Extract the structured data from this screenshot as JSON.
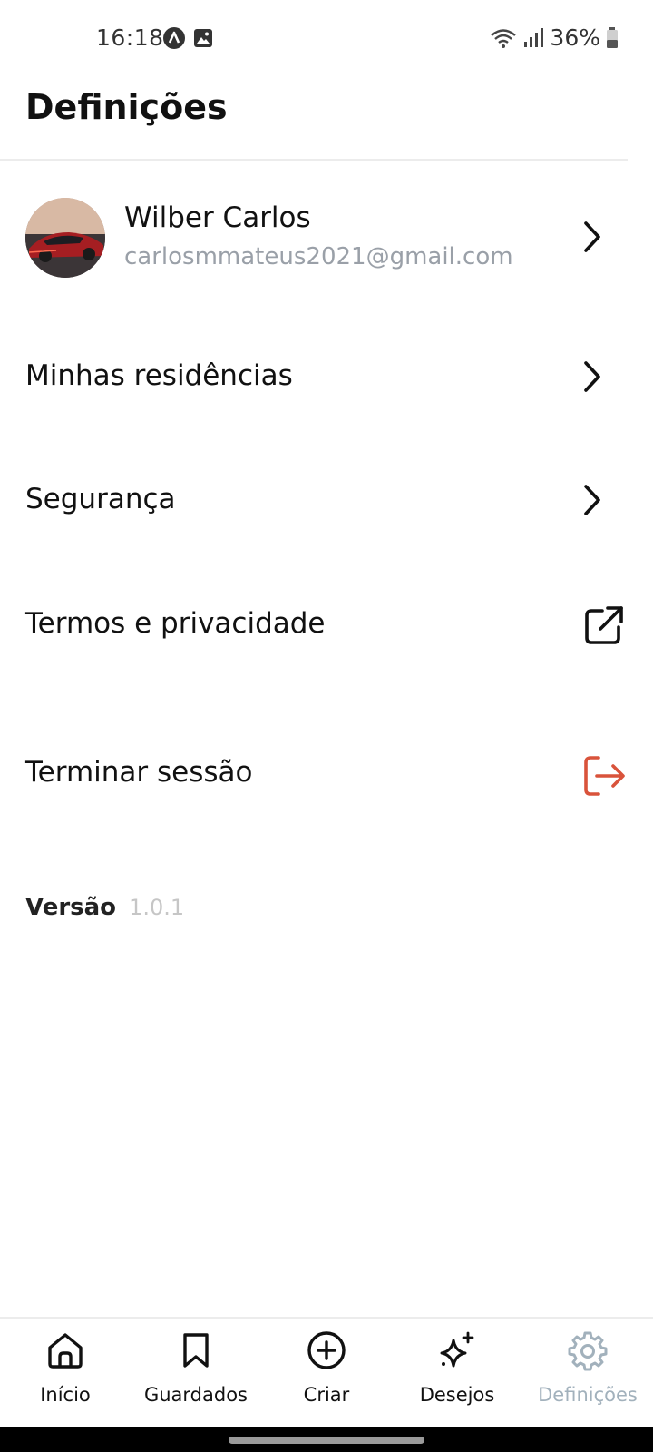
{
  "status_bar": {
    "time": "16:18",
    "battery_percent": "36%",
    "icons": [
      "app-notification-icon",
      "gallery-notification-icon",
      "wifi-icon",
      "signal-icon",
      "battery-icon"
    ]
  },
  "header": {
    "title": "Definições"
  },
  "profile": {
    "name": "Wilber Carlos",
    "email": "carlosmmateus2021@gmail.com"
  },
  "menu": {
    "residences": "Minhas residências",
    "security": "Segurança",
    "terms": "Termos e privacidade",
    "logout": "Terminar sessão"
  },
  "version": {
    "label": "Versão",
    "value": "1.0.1"
  },
  "bottom_nav": {
    "items": [
      {
        "label": "Início",
        "icon": "home-icon"
      },
      {
        "label": "Guardados",
        "icon": "bookmark-icon"
      },
      {
        "label": "Criar",
        "icon": "plus-circle-icon"
      },
      {
        "label": "Desejos",
        "icon": "sparkles-icon"
      },
      {
        "label": "Definições",
        "icon": "gear-icon"
      }
    ],
    "active_index": 4
  },
  "colors": {
    "logout_accent": "#d9533b",
    "inactive_gray": "#9aa0a8",
    "active_nav": "#a2b1bc"
  }
}
